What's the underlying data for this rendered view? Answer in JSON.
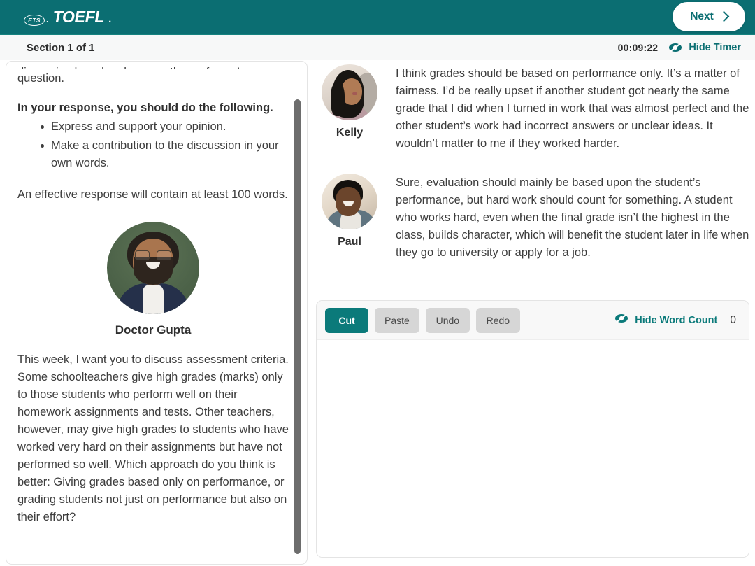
{
  "header": {
    "brand_ets": "ETS",
    "brand_toefl": "TOEFL",
    "brand_period": ".",
    "next_label": "Next",
    "accent_teal": "#0b6e72"
  },
  "section_bar": {
    "title": "Section 1 of 1",
    "timer": "00:09:22",
    "hide_timer_label": "Hide Timer",
    "teal": "#0b6e72"
  },
  "prompt_panel": {
    "clipped_line": "discussion board and answer the professor's",
    "intro_tail": "question.",
    "instructions_heading": "In your response, you should do the following.",
    "instructions": [
      "Express and support your opinion.",
      "Make a contribution to the discussion in your own words."
    ],
    "effective_note": "An effective response will contain at least 100 words.",
    "professor_name": "Doctor Gupta",
    "professor_post": "This week, I want you to discuss assessment criteria. Some schoolteachers give high grades (marks) only to those students who perform well on their homework assignments and tests. Other teachers, however, may give high grades to students who have worked very hard on their assignments but have not performed so well. Which approach do you think is better: Giving grades based only on performance, or grading students not just on performance but also on their effort?"
  },
  "discussion": {
    "posts": [
      {
        "author": "Kelly",
        "text": "I think grades should be based on performance only. It’s a matter of fairness. I’d be really upset if another student got nearly the same grade that I did when I turned in work that was almost perfect and the other student’s work had incorrect answers or unclear ideas. It wouldn’t matter to me if they worked harder."
      },
      {
        "author": "Paul",
        "text": "Sure, evaluation should mainly be based upon the student’s performance, but hard work should count for something. A student who works hard, even when the final grade isn’t the highest in the class, builds character, which will benefit the student later in life when they go to university or apply for a job."
      }
    ]
  },
  "editor": {
    "toolbar": {
      "cut_label": "Cut",
      "paste_label": "Paste",
      "undo_label": "Undo",
      "redo_label": "Redo",
      "hide_word_count_label": "Hide Word Count",
      "word_count": "0",
      "active_button": "Cut",
      "active_color": "#0b7a7a",
      "disabled_color": "#d6d6d6"
    },
    "response_value": "",
    "response_placeholder": ""
  }
}
